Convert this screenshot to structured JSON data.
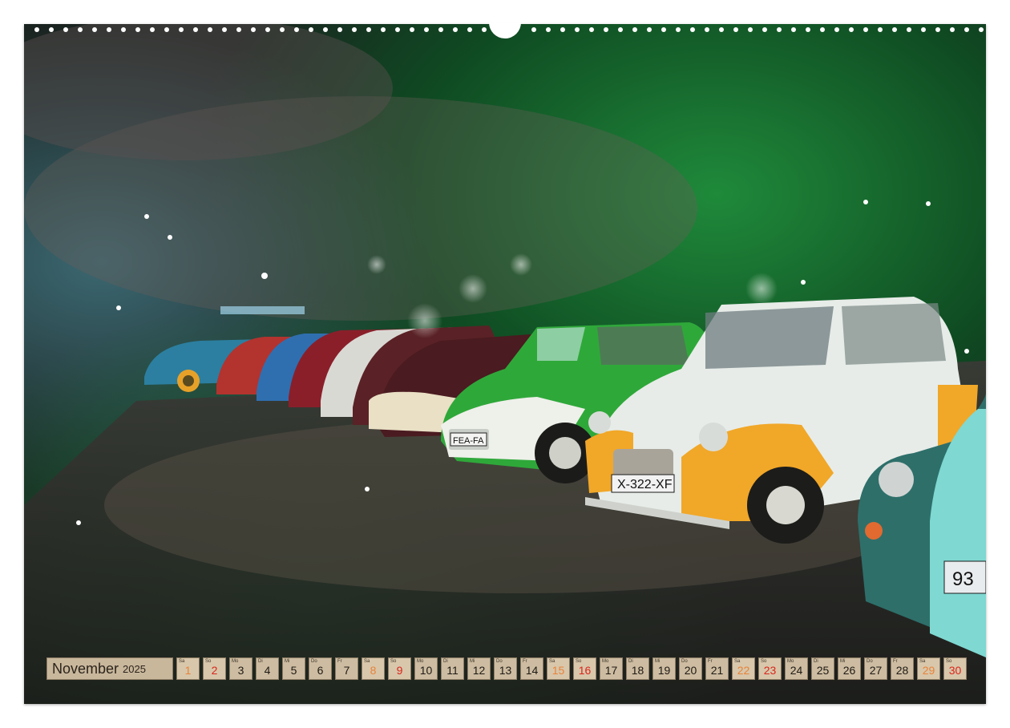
{
  "calendar": {
    "month": "November",
    "year": "2025",
    "days": [
      {
        "dow": "Sa",
        "num": "1",
        "type": "sat"
      },
      {
        "dow": "So",
        "num": "2",
        "type": "sun"
      },
      {
        "dow": "Mo",
        "num": "3",
        "type": "weekday"
      },
      {
        "dow": "Di",
        "num": "4",
        "type": "weekday"
      },
      {
        "dow": "Mi",
        "num": "5",
        "type": "weekday"
      },
      {
        "dow": "Do",
        "num": "6",
        "type": "weekday"
      },
      {
        "dow": "Fr",
        "num": "7",
        "type": "weekday"
      },
      {
        "dow": "Sa",
        "num": "8",
        "type": "sat"
      },
      {
        "dow": "So",
        "num": "9",
        "type": "sun"
      },
      {
        "dow": "Mo",
        "num": "10",
        "type": "weekday"
      },
      {
        "dow": "Di",
        "num": "11",
        "type": "weekday"
      },
      {
        "dow": "Mi",
        "num": "12",
        "type": "weekday"
      },
      {
        "dow": "Do",
        "num": "13",
        "type": "weekday"
      },
      {
        "dow": "Fr",
        "num": "14",
        "type": "weekday"
      },
      {
        "dow": "Sa",
        "num": "15",
        "type": "sat"
      },
      {
        "dow": "So",
        "num": "16",
        "type": "sun"
      },
      {
        "dow": "Mo",
        "num": "17",
        "type": "weekday"
      },
      {
        "dow": "Di",
        "num": "18",
        "type": "weekday"
      },
      {
        "dow": "Mi",
        "num": "19",
        "type": "weekday"
      },
      {
        "dow": "Do",
        "num": "20",
        "type": "weekday"
      },
      {
        "dow": "Fr",
        "num": "21",
        "type": "weekday"
      },
      {
        "dow": "Sa",
        "num": "22",
        "type": "sat"
      },
      {
        "dow": "So",
        "num": "23",
        "type": "sun"
      },
      {
        "dow": "Mo",
        "num": "24",
        "type": "weekday"
      },
      {
        "dow": "Di",
        "num": "25",
        "type": "weekday"
      },
      {
        "dow": "Mi",
        "num": "26",
        "type": "weekday"
      },
      {
        "dow": "Do",
        "num": "27",
        "type": "weekday"
      },
      {
        "dow": "Fr",
        "num": "28",
        "type": "weekday"
      },
      {
        "dow": "Sa",
        "num": "29",
        "type": "sat"
      },
      {
        "dow": "So",
        "num": "30",
        "type": "sun"
      }
    ]
  },
  "photo": {
    "plates": [
      "X-322-XF",
      "FEA-FA",
      "93"
    ]
  },
  "colors": {
    "saturday": "#e8833a",
    "sunday": "#d9261c",
    "cell_bg": "#cdbca1"
  }
}
